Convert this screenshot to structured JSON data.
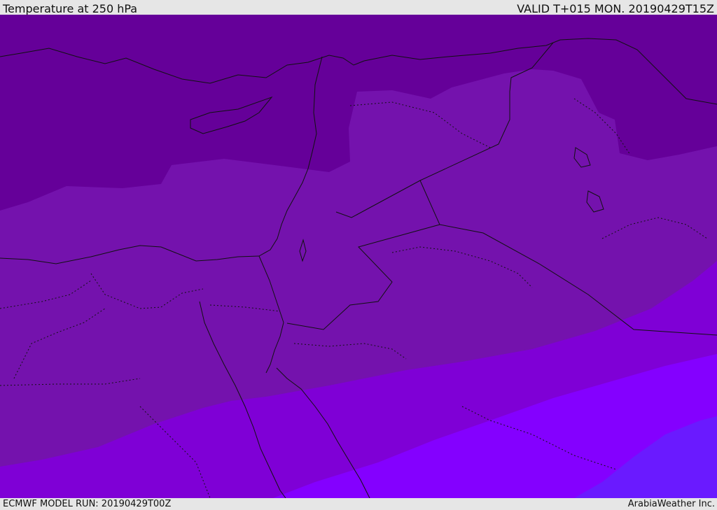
{
  "header": {
    "title": "Temperature at 250 hPa",
    "valid": "VALID T+015 MON. 20190429T15Z"
  },
  "footer": {
    "model_run": "ECMWF MODEL RUN: 20190429T00Z",
    "credit": "ArabiaWeather Inc."
  },
  "colors": {
    "band_darkest": "#650099",
    "band_dark": "#7412ad",
    "band_mid": "#7f00d6",
    "band_light": "#8400ff",
    "band_blue": "#6a1aff",
    "boundary_line": "#111111"
  }
}
